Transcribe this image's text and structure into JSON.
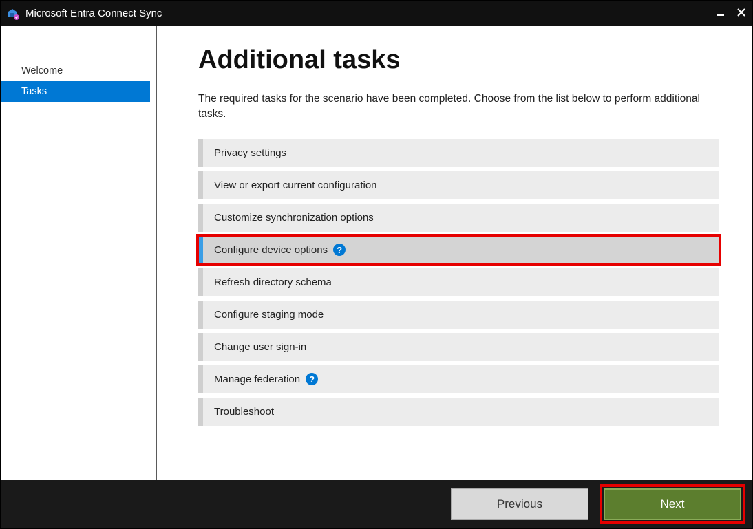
{
  "titlebar": {
    "title": "Microsoft Entra Connect Sync"
  },
  "sidebar": {
    "items": [
      {
        "label": "Welcome",
        "active": false
      },
      {
        "label": "Tasks",
        "active": true
      }
    ]
  },
  "main": {
    "heading": "Additional tasks",
    "description": "The required tasks for the scenario have been completed. Choose from the list below to perform additional tasks.",
    "tasks": [
      {
        "label": "Privacy settings",
        "selected": false,
        "help": false,
        "highlight": false
      },
      {
        "label": "View or export current configuration",
        "selected": false,
        "help": false,
        "highlight": false
      },
      {
        "label": "Customize synchronization options",
        "selected": false,
        "help": false,
        "highlight": false
      },
      {
        "label": "Configure device options",
        "selected": true,
        "help": true,
        "highlight": true
      },
      {
        "label": "Refresh directory schema",
        "selected": false,
        "help": false,
        "highlight": false
      },
      {
        "label": "Configure staging mode",
        "selected": false,
        "help": false,
        "highlight": false
      },
      {
        "label": "Change user sign-in",
        "selected": false,
        "help": false,
        "highlight": false
      },
      {
        "label": "Manage federation",
        "selected": false,
        "help": true,
        "highlight": false
      },
      {
        "label": "Troubleshoot",
        "selected": false,
        "help": false,
        "highlight": false
      }
    ]
  },
  "footer": {
    "previous": "Previous",
    "next": "Next",
    "nextHighlight": true
  },
  "icons": {
    "help": "?"
  }
}
